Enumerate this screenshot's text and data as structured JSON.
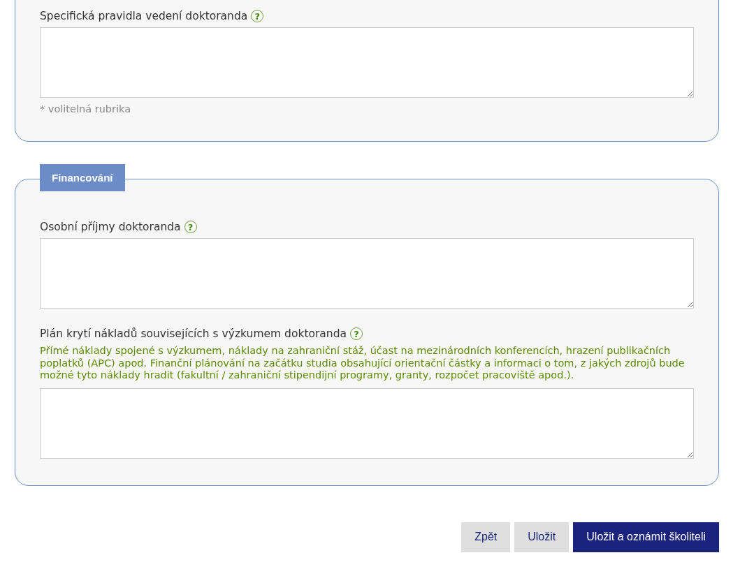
{
  "sections": [
    {
      "fields": [
        {
          "label": "Specifická pravidla vedení doktoranda",
          "help": "?",
          "note": "* volitelná rubrika"
        }
      ]
    },
    {
      "legend": "Financování",
      "fields": [
        {
          "label": "Osobní příjmy doktoranda",
          "help": "?"
        },
        {
          "label": "Plán krytí nákladů souvisejících s výzkumem doktoranda",
          "help": "?",
          "hint": "Přímé náklady spojené s výzkumem, náklady na zahraniční stáž, účast na mezinárodních konferencích, hrazení publikačních poplatků (APC) apod. Finanční plánování na začátku studia obsahující orientační částky a informaci o tom, z jakých zdrojů bude možné tyto náklady hradit (fakultní / zahraniční stipendijní programy, granty, rozpočet pracoviště apod.)."
        }
      ]
    }
  ],
  "buttons": [
    {
      "label": "Zpět",
      "kind": "secondary"
    },
    {
      "label": "Uložit",
      "kind": "secondary"
    },
    {
      "label": "Uložit a oznámit školiteli",
      "kind": "primary"
    }
  ]
}
